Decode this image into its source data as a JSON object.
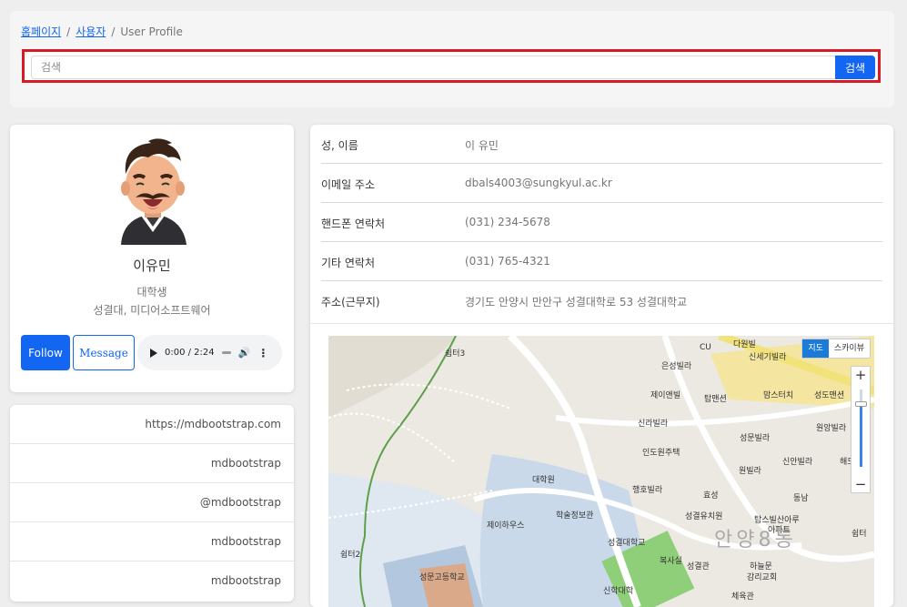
{
  "breadcrumb": {
    "home": "홈페이지",
    "users": "사용자",
    "current": "User Profile",
    "separator": "/"
  },
  "search": {
    "placeholder": "검색",
    "button": "검색"
  },
  "profile": {
    "name": "이유민",
    "role": "대학생",
    "school": "성결대, 미디어소프트웨어",
    "follow": "Follow",
    "message": "Message",
    "audio_time": "0:00 / 2:24"
  },
  "links": [
    "https://mdbootstrap.com",
    "mdbootstrap",
    "@mdbootstrap",
    "mdbootstrap",
    "mdbootstrap"
  ],
  "info": [
    {
      "key": "성, 이름",
      "value": "이 유민"
    },
    {
      "key": "이메일 주소",
      "value": "dbals4003@sungkyul.ac.kr"
    },
    {
      "key": "핸드폰 연락처",
      "value": "(031) 234-5678"
    },
    {
      "key": "기타 연락처",
      "value": "(031) 765-4321"
    },
    {
      "key": "주소(근무지)",
      "value": "경기도 안양시 만안구 성결대학로 53 성결대학교"
    }
  ],
  "map": {
    "type_map": "지도",
    "type_sky": "스카이뷰",
    "zoom_in": "+",
    "zoom_out": "−",
    "labels": [
      "쉼터3",
      "CU",
      "다원빌",
      "신세기빌라",
      "은성빌라",
      "제이앤빌",
      "탑맨션",
      "맘스터치",
      "성도맨션",
      "신라빌라",
      "원앙빌라",
      "인도원주택",
      "성문빌라",
      "대학원",
      "해드",
      "원빌라",
      "신안빌라",
      "행호빌라",
      "효성",
      "동남",
      "학술정보관",
      "제이하우스",
      "성결유치원",
      "탑스빌산아루",
      "아파트",
      "쉼터",
      "성결대학교",
      "안양8동",
      "쉼터2",
      "성문고등학교",
      "복사실",
      "성결관",
      "하늘문",
      "감리교회",
      "신학대학",
      "체육관"
    ]
  },
  "colors": {
    "primary": "#1266f1",
    "highlight": "#d61a26"
  }
}
